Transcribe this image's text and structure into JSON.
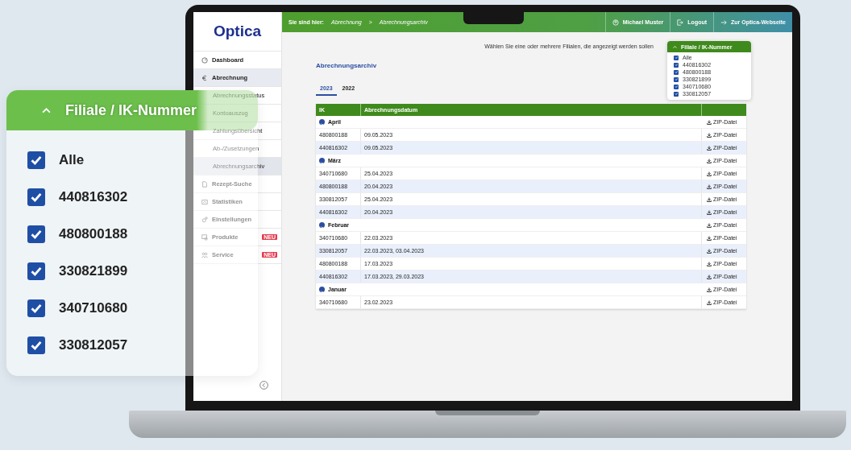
{
  "logo": "Optica",
  "breadcrumb": {
    "label": "Sie sind hier:",
    "items": [
      "Abrechnung",
      "Abrechnungsarchiv"
    ],
    "separator": ">"
  },
  "top_links": [
    {
      "label": "Michael Muster"
    },
    {
      "label": "Logout"
    },
    {
      "label": "Zur Optica-Webseite"
    }
  ],
  "sidebar": {
    "items": [
      {
        "label": "Dashboard",
        "selected": false
      },
      {
        "label": "Abrechnung",
        "selected": true,
        "expanded": true,
        "children": [
          {
            "label": "Abrechnungsstatus",
            "selected": false
          },
          {
            "label": "Kontoauszug",
            "selected": false
          },
          {
            "label": "Zahlungsübersicht",
            "selected": false
          },
          {
            "label": "Ab-/Zusetzungen",
            "selected": false
          },
          {
            "label": "Abrechnungsarchiv",
            "selected": true
          }
        ]
      },
      {
        "label": "Rezept-Suche",
        "selected": false
      },
      {
        "label": "Statistiken",
        "selected": false
      },
      {
        "label": "Einstellungen",
        "selected": false
      },
      {
        "label": "Produkte",
        "selected": false,
        "badge": "NEU"
      },
      {
        "label": "Service",
        "selected": false,
        "badge": "NEU"
      }
    ]
  },
  "instruction": "Wählen Sie eine oder mehrere Filialen, die angezeigt werden sollen",
  "filter": {
    "title": "Filiale / IK-Nummer",
    "expanded": true,
    "options": [
      {
        "label": "Alle",
        "checked": true
      },
      {
        "label": "440816302",
        "checked": true
      },
      {
        "label": "480800188",
        "checked": true
      },
      {
        "label": "330821899",
        "checked": true
      },
      {
        "label": "340710680",
        "checked": true
      },
      {
        "label": "330812057",
        "checked": true
      }
    ]
  },
  "page_title": "Abrechnungsarchiv",
  "tabs": [
    {
      "label": "2023",
      "selected": true
    },
    {
      "label": "2022",
      "selected": false
    }
  ],
  "table": {
    "columns": [
      "IK",
      "Abrechnungsdatum"
    ],
    "rows": [
      {
        "kind": "group",
        "label": "April",
        "expanded": true,
        "download": "ZIP-Datei"
      },
      {
        "kind": "entry",
        "ik": "480800188",
        "date": "09.05.2023",
        "download": "ZIP-Datei"
      },
      {
        "kind": "entry",
        "ik": "440816302",
        "date": "09.05.2023",
        "download": "ZIP-Datei"
      },
      {
        "kind": "group",
        "label": "März",
        "expanded": true,
        "download": "ZIP-Datei"
      },
      {
        "kind": "entry",
        "ik": "340710680",
        "date": "25.04.2023",
        "download": "ZIP-Datei"
      },
      {
        "kind": "entry",
        "ik": "480800188",
        "date": "20.04.2023",
        "download": "ZIP-Datei"
      },
      {
        "kind": "entry",
        "ik": "330812057",
        "date": "25.04.2023",
        "download": "ZIP-Datei"
      },
      {
        "kind": "entry",
        "ik": "440816302",
        "date": "20.04.2023",
        "download": "ZIP-Datei"
      },
      {
        "kind": "group",
        "label": "Februar",
        "expanded": true,
        "download": "ZIP-Datei"
      },
      {
        "kind": "entry",
        "ik": "340710680",
        "date": "22.03.2023",
        "download": "ZIP-Datei"
      },
      {
        "kind": "entry",
        "ik": "330812057",
        "date": "22.03.2023, 03.04.2023",
        "download": "ZIP-Datei"
      },
      {
        "kind": "entry",
        "ik": "480800188",
        "date": "17.03.2023",
        "download": "ZIP-Datei"
      },
      {
        "kind": "entry",
        "ik": "440816302",
        "date": "17.03.2023, 29.03.2023",
        "download": "ZIP-Datei"
      },
      {
        "kind": "group",
        "label": "Januar",
        "expanded": true,
        "download": "ZIP-Datei"
      },
      {
        "kind": "entry",
        "ik": "340710680",
        "date": "23.02.2023",
        "download": "ZIP-Datei"
      }
    ]
  },
  "zoom_panel": {
    "title": "Filiale / IK-Nummer",
    "expanded": true,
    "options": [
      {
        "label": "Alle",
        "checked": true
      },
      {
        "label": "440816302",
        "checked": true
      },
      {
        "label": "480800188",
        "checked": true
      },
      {
        "label": "330821899",
        "checked": true
      },
      {
        "label": "340710680",
        "checked": true
      },
      {
        "label": "330812057",
        "checked": true
      }
    ]
  }
}
